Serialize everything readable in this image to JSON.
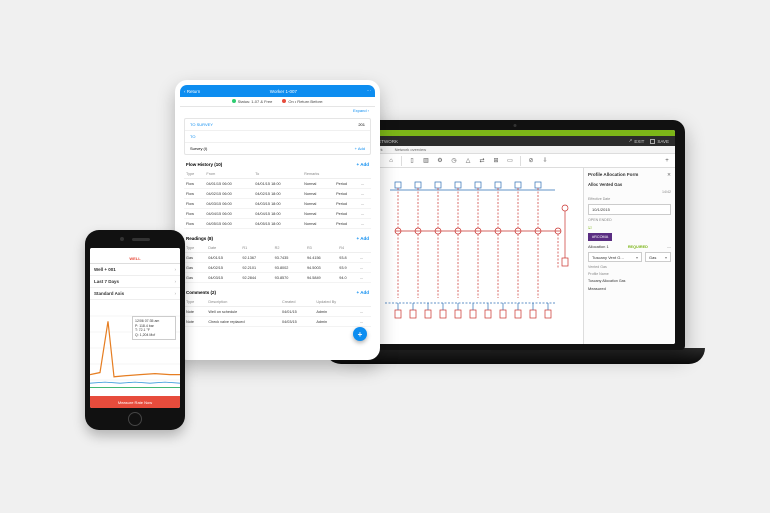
{
  "phone": {
    "header": "WELL",
    "well_row": {
      "label": "Well + 001",
      "detail": ""
    },
    "range_row": {
      "label": "Last 7 Days",
      "detail": ""
    },
    "axis_row": {
      "label": "Standard Axis",
      "detail": ""
    },
    "callout": {
      "l1": "12/06 07:35 am",
      "l2": "P: 118.4 bar",
      "l3": "T: 72.1 °F",
      "l4": "Q: 1,204 Mcf"
    },
    "footer": "Measure Rate Now"
  },
  "tablet": {
    "back": "‹ Return",
    "title": "Worker 1-007",
    "status_left": "Status: 1-07 & Free",
    "status_right": "On • Return Before:",
    "expand": "Expand ›",
    "info": [
      {
        "k": "TO SURVEY",
        "v": "201"
      },
      {
        "k": "TO",
        "v": ""
      },
      {
        "k": "Survey (I)",
        "v": "+ Add"
      }
    ],
    "flow": {
      "title": "Flow History  (10)",
      "add": "+ Add",
      "cols": [
        "Type",
        "From",
        "To",
        "Remarks",
        "",
        ""
      ],
      "rows": [
        [
          "Flow",
          "04/01/15 06:00",
          "04/01/15 18:00",
          "Normal",
          "Period",
          "..."
        ],
        [
          "Flow",
          "04/02/15 06:00",
          "04/02/15 18:00",
          "Normal",
          "Period",
          "..."
        ],
        [
          "Flow",
          "04/03/15 06:00",
          "04/03/15 18:00",
          "Normal",
          "Period",
          "..."
        ],
        [
          "Flow",
          "04/04/15 06:00",
          "04/04/15 18:00",
          "Normal",
          "Period",
          "..."
        ],
        [
          "Flow",
          "04/05/15 06:00",
          "04/05/15 18:00",
          "Normal",
          "Period",
          "..."
        ]
      ]
    },
    "readings": {
      "title": "Readings (8)",
      "add": "+ Add",
      "cols": [
        "Type",
        "Date",
        "R1",
        "R2",
        "R3",
        "R4",
        ""
      ],
      "rows": [
        [
          "Gas",
          "04/01/15",
          "92.1367",
          "93.7435",
          "94.4156",
          "93.8",
          "..."
        ],
        [
          "Gas",
          "04/02/15",
          "92.2101",
          "93.8002",
          "94.5003",
          "93.9",
          "..."
        ],
        [
          "Gas",
          "04/03/15",
          "92.2844",
          "93.8570",
          "94.5849",
          "94.0",
          "..."
        ]
      ]
    },
    "comments": {
      "title": "Comments (2)",
      "add": "+ Add",
      "cols": [
        "Type",
        "Description",
        "Created",
        "Updated By",
        ""
      ],
      "rows": [
        [
          "Note",
          "Well on schedule",
          "04/01/15",
          "Admin",
          "..."
        ],
        [
          "Note",
          "Check valve replaced",
          "04/03/15",
          "Admin",
          "..."
        ]
      ]
    }
  },
  "laptop": {
    "appbar_left": "FIELD NETWORK",
    "exit": "EXIT",
    "save": "SAVE",
    "tabs": [
      "Flow network",
      "Network overview"
    ],
    "panel": {
      "title": "Profile Allocation Form",
      "subtitle": "Alloc Vented Gas",
      "ratio": "14/42",
      "eff_label": "Effective Date",
      "eff_value": "10/1/2015",
      "open_label": "OPEN ENDED",
      "open_icon": "☑",
      "tag": "#RCOMA",
      "alloc_label": "Allocation 1",
      "required": "REQUIRED",
      "source_label": "Tuscany Vent G…",
      "type_label": "Gas",
      "vented_label": "Vented Gas",
      "profile_label": "Profile Name",
      "tuscany_label": "Tuscany Allocation Gas",
      "measured": "Measured"
    }
  }
}
